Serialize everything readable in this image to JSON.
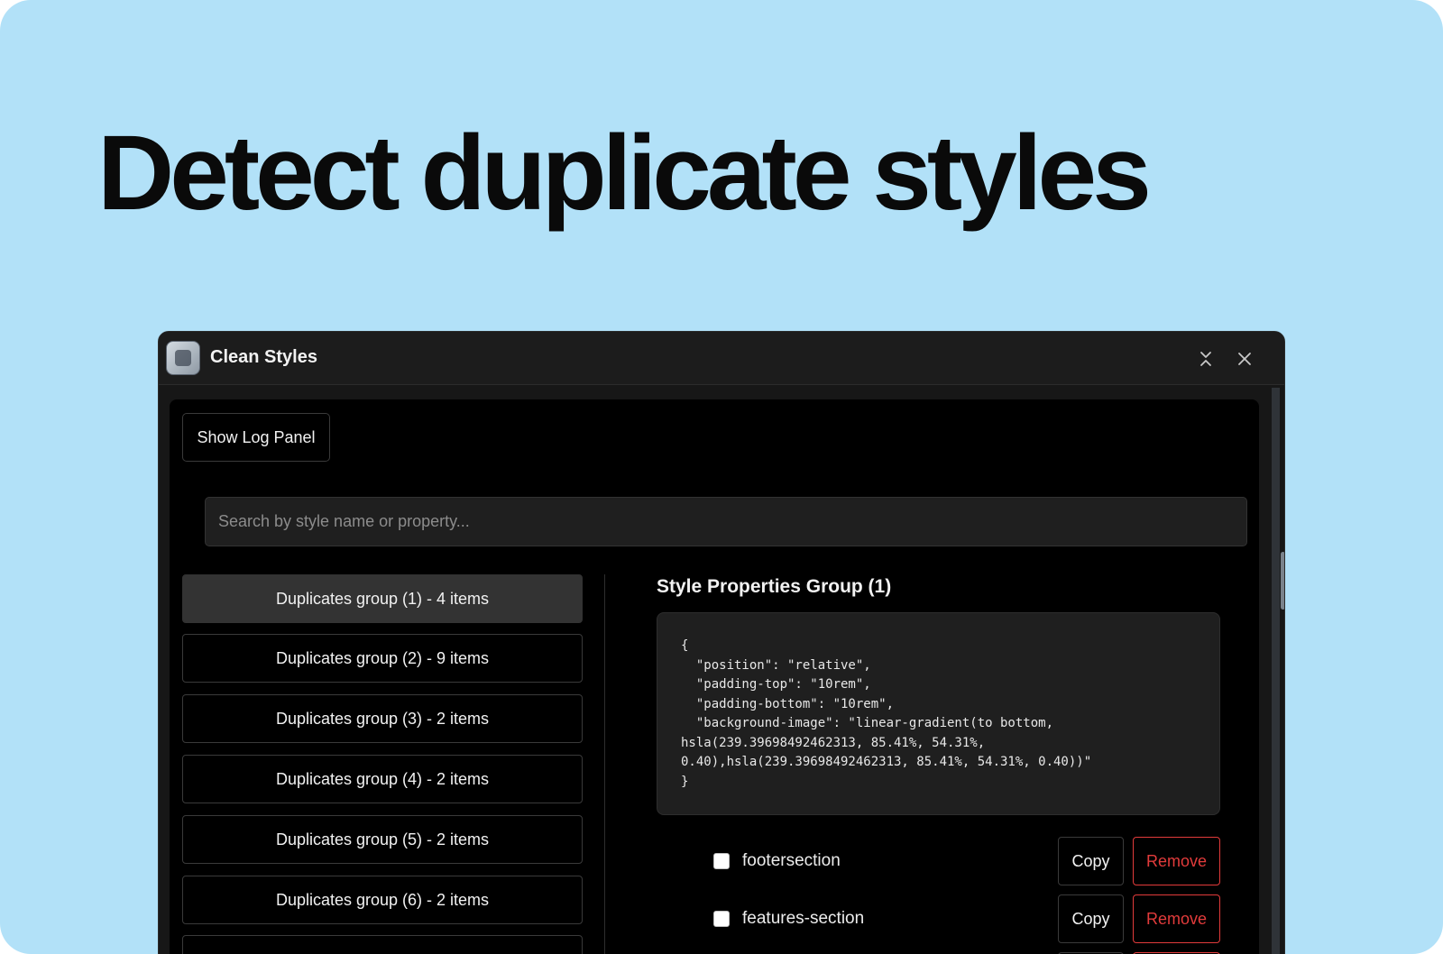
{
  "banner": {
    "headline": "Detect duplicate styles",
    "background_color": "#b2e1f8"
  },
  "window": {
    "title": "Clean Styles",
    "app_icon": "clean-styles-app-icon",
    "controls": {
      "collapse_icon": "collapse-arrows-icon",
      "close_icon": "close-icon"
    }
  },
  "toolbar": {
    "log_button_label": "Show Log Panel"
  },
  "search": {
    "placeholder": "Search by style name or property...",
    "value": ""
  },
  "groups": [
    {
      "label": "Duplicates group (1) - 4 items",
      "active": true
    },
    {
      "label": "Duplicates group (2) - 9 items",
      "active": false
    },
    {
      "label": "Duplicates group (3) - 2 items",
      "active": false
    },
    {
      "label": "Duplicates group (4) - 2 items",
      "active": false
    },
    {
      "label": "Duplicates group (5) - 2 items",
      "active": false
    },
    {
      "label": "Duplicates group (6) - 2 items",
      "active": false
    }
  ],
  "detail": {
    "title": "Style Properties Group (1)",
    "code": "{\n  \"position\": \"relative\",\n  \"padding-top\": \"10rem\",\n  \"padding-bottom\": \"10rem\",\n  \"background-image\": \"linear-gradient(to bottom,\nhsla(239.39698492462313, 85.41%, 54.31%,\n0.40),hsla(239.39698492462313, 85.41%, 54.31%, 0.40))\"\n}",
    "copy_label": "Copy",
    "remove_label": "Remove",
    "remove_color": "#e23b3b",
    "styles": [
      {
        "name": "footersection",
        "checked": false
      },
      {
        "name": "features-section",
        "checked": false
      }
    ]
  }
}
